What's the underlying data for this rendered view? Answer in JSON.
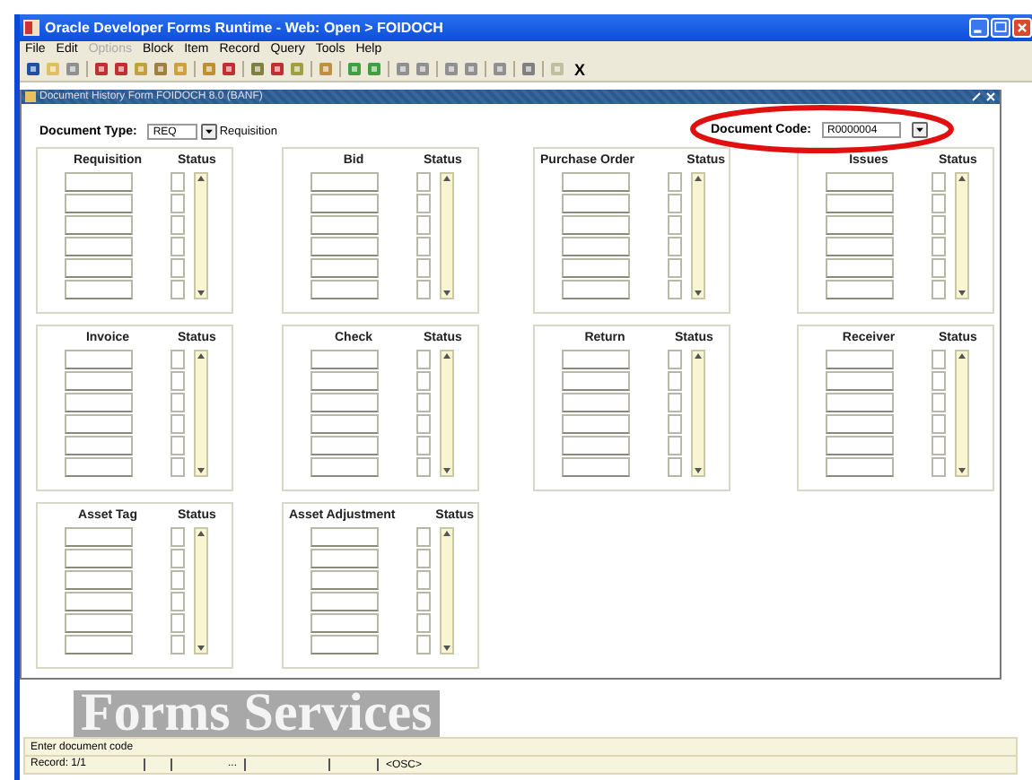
{
  "window": {
    "title": "Oracle Developer Forms Runtime - Web:  Open > FOIDOCH"
  },
  "menu": [
    {
      "label": "File",
      "disabled": false
    },
    {
      "label": "Edit",
      "disabled": false
    },
    {
      "label": "Options",
      "disabled": true
    },
    {
      "label": "Block",
      "disabled": false
    },
    {
      "label": "Item",
      "disabled": false
    },
    {
      "label": "Record",
      "disabled": false
    },
    {
      "label": "Query",
      "disabled": false
    },
    {
      "label": "Tools",
      "disabled": false
    },
    {
      "label": "Help",
      "disabled": false
    }
  ],
  "toolbar": {
    "exit_label": "X"
  },
  "form": {
    "title": "Document History Form  FOIDOCH  8.0  (BANF)",
    "document_type": {
      "label": "Document Type:",
      "value": "REQ",
      "description": "Requisition"
    },
    "document_code": {
      "label": "Document Code:",
      "value": "R0000004",
      "highlighted": true
    },
    "blocks": [
      {
        "title": "Requisition",
        "status_label": "Status"
      },
      {
        "title": "Bid",
        "status_label": "Status"
      },
      {
        "title": "Purchase Order",
        "status_label": "Status"
      },
      {
        "title": "Issues",
        "status_label": "Status"
      },
      {
        "title": "Invoice",
        "status_label": "Status"
      },
      {
        "title": "Check",
        "status_label": "Status"
      },
      {
        "title": "Return",
        "status_label": "Status"
      },
      {
        "title": "Receiver",
        "status_label": "Status"
      },
      {
        "title": "Asset Tag",
        "status_label": "Status"
      },
      {
        "title": "Asset Adjustment",
        "status_label": "Status"
      }
    ]
  },
  "background_text": "Forms Services",
  "status_bar": {
    "message": "Enter document code",
    "record": "Record: 1/1",
    "ellipsis": "...",
    "mode": "<OSC>"
  }
}
